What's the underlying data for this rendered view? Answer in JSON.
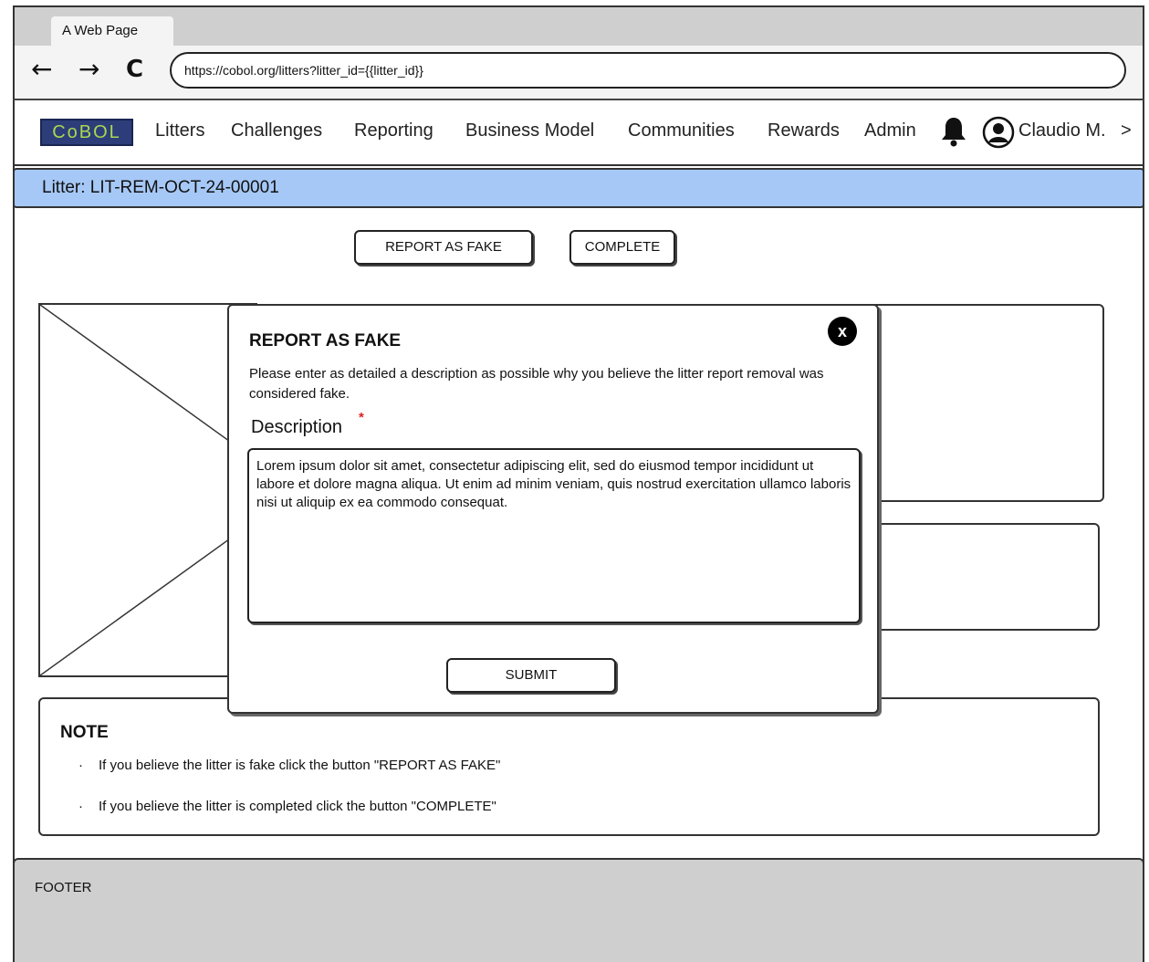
{
  "browser": {
    "tab_title": "A Web Page",
    "back_icon": "←",
    "forward_icon": "→",
    "reload_icon": "C",
    "url": "https://cobol.org/litters?litter_id={{litter_id}}"
  },
  "header": {
    "logo_text": "CoBOL",
    "menu": [
      "Litters",
      "Challenges",
      "Reporting",
      "Business Model",
      "Communities",
      "Rewards",
      "Admin"
    ],
    "user_name": "Claudio M.",
    "chevron": ">"
  },
  "page": {
    "title": "Litter: LIT-REM-OCT-24-00001",
    "report_fake_label": "REPORT AS FAKE",
    "complete_label": "COMPLETE"
  },
  "modal": {
    "title": "REPORT AS FAKE",
    "close_icon": "x",
    "description": "Please enter as detailed a description as possible why you believe the litter report removal was considered fake.",
    "field_label": "Description",
    "required_mark": "*",
    "field_value": "Lorem ipsum dolor sit amet, consectetur adipiscing elit, sed do eiusmod tempor incididunt ut labore et dolore magna aliqua. Ut enim ad minim veniam, quis nostrud exercitation ullamco laboris nisi ut aliquip ex ea commodo consequat.",
    "submit_label": "SUBMIT"
  },
  "note": {
    "title": "NOTE",
    "bullets": [
      "If you believe the litter is fake click the button \"REPORT AS FAKE\"",
      "If you believe the litter is completed click the button \"COMPLETE\""
    ]
  },
  "footer": {
    "label": "FOOTER"
  },
  "colors": {
    "title_bar": "#a6c8f6",
    "logo_bg": "#2c3d7a",
    "logo_text": "#a8d84e",
    "chrome_bg": "#cfcfcf",
    "required": "#e02020"
  }
}
